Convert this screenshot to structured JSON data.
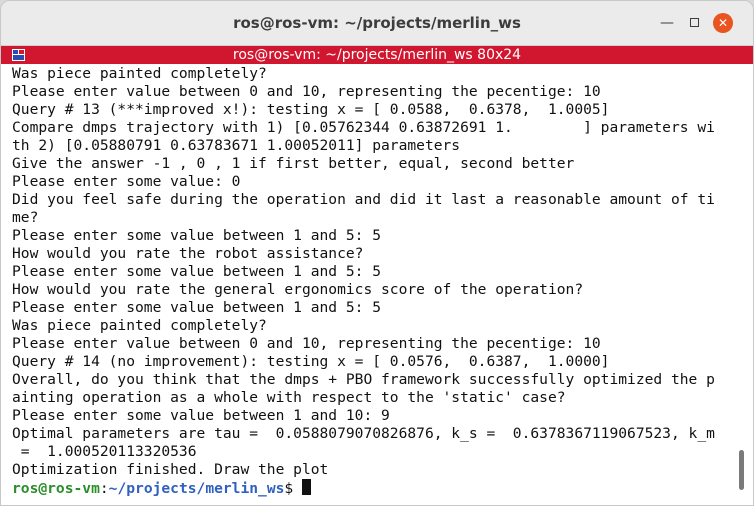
{
  "window": {
    "title": "ros@ros-vm: ~/projects/merlin_ws",
    "minimize_glyph": "—",
    "close_glyph": "✕",
    "colors": {
      "tabbar": "#d1172f",
      "close": "#e95420"
    }
  },
  "tab": {
    "label": "ros@ros-vm: ~/projects/merlin_ws 80x24",
    "icon": "terminal-tab-icon"
  },
  "terminal": {
    "lines": [
      "Was piece painted completely?",
      "Please enter value between 0 and 10, representing the pecentige: 10",
      "Query # 13 (***improved x!): testing x = [ 0.0588,  0.6378,  1.0005]",
      "Compare dmps trajectory with 1) [0.05762344 0.63872691 1.        ] parameters wi",
      "th 2) [0.05880791 0.63783671 1.00052011] parameters",
      "Give the answer -1 , 0 , 1 if first better, equal, second better",
      "Please enter some value: 0",
      "Did you feel safe during the operation and did it last a reasonable amount of ti",
      "me?",
      "Please enter some value between 1 and 5: 5",
      "How would you rate the robot assistance?",
      "Please enter some value between 1 and 5: 5",
      "How would you rate the general ergonomics score of the operation?",
      "Please enter some value between 1 and 5: 5",
      "Was piece painted completely?",
      "Please enter value between 0 and 10, representing the pecentige: 10",
      "Query # 14 (no improvement): testing x = [ 0.0576,  0.6387,  1.0000]",
      "Overall, do you think that the dmps + PBO framework successfully optimized the p",
      "ainting operation as a whole with respect to the 'static' case?",
      "Please enter some value between 1 and 10: 9",
      "Optimal parameters are tau =  0.0588079070826876, k_s =  0.6378367119067523, k_m",
      " =  1.000520113320536",
      "Optimization finished. Draw the plot"
    ],
    "prompt": {
      "user_host": "ros@ros-vm",
      "separator": ":",
      "path": "~/projects/merlin_ws",
      "symbol": "$ "
    }
  }
}
